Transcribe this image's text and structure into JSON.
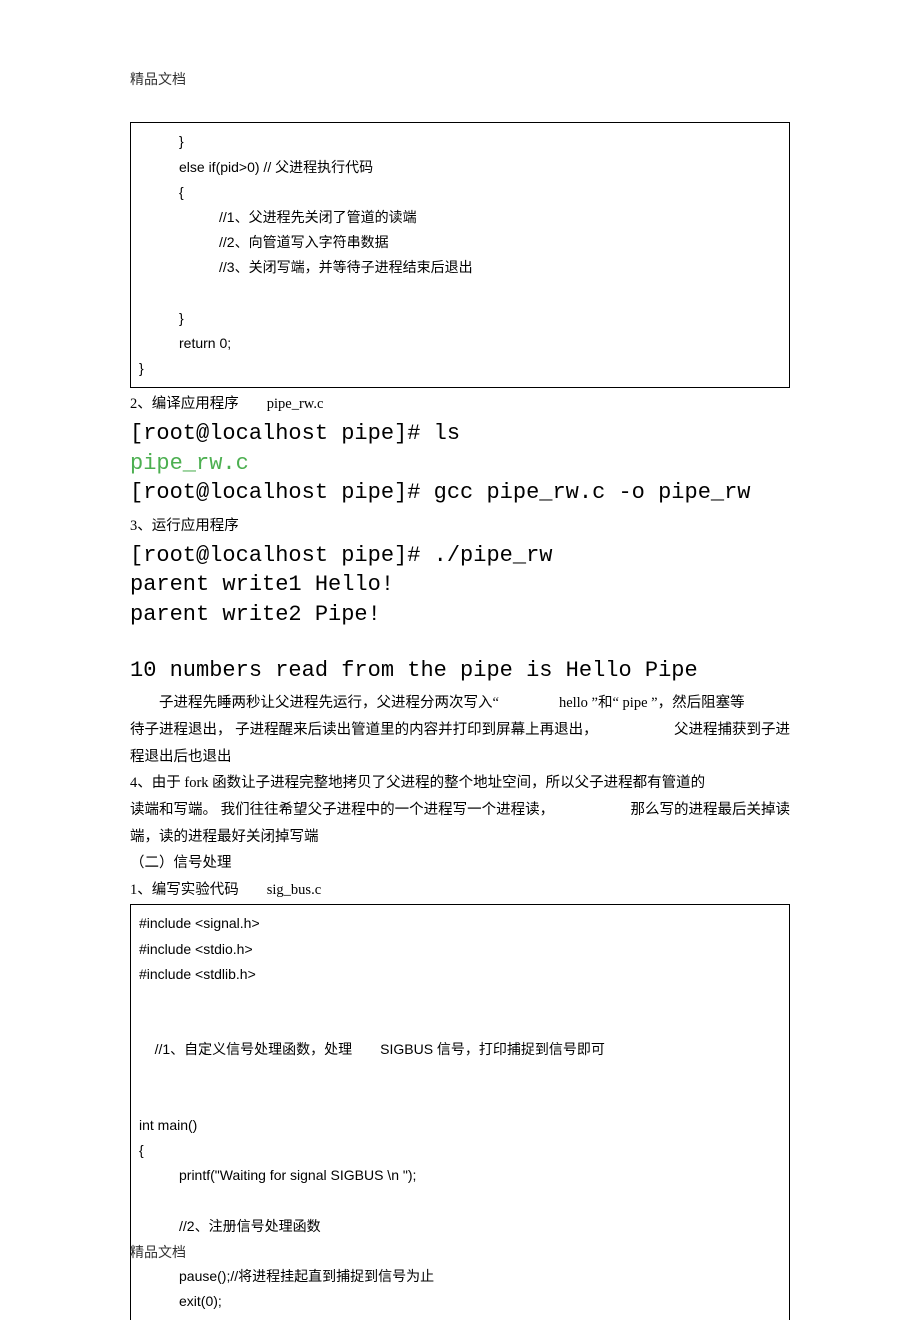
{
  "header": {
    "text": "精品文档"
  },
  "footer": {
    "text": "精品文档"
  },
  "code_block_1": {
    "l1": "}",
    "l2": "else if(pid>0) // 父进程执行代码",
    "l3": "{",
    "l4": "//1、父进程先关闭了管道的读端",
    "l5": "//2、向管道写入字符串数据",
    "l6": "//3、关闭写端，并等待子进程结束后退出",
    "l7": "}",
    "l8": "return 0;",
    "l9": "}"
  },
  "step2": {
    "label": "2、编译应用程序",
    "file": "pipe_rw.c"
  },
  "terminal1": {
    "l1": "[root@localhost pipe]# ls",
    "l2": "pipe_rw.c",
    "l3": "[root@localhost pipe]# gcc pipe_rw.c -o pipe_rw"
  },
  "step3": {
    "label": "3、运行应用程序"
  },
  "terminal2": {
    "l1": "[root@localhost pipe]# ./pipe_rw",
    "l2": "parent write1 Hello!",
    "l3": "parent write2 Pipe!",
    "l4": "10 numbers read from the pipe is Hello Pipe"
  },
  "paragraph1": {
    "part1": "子进程先睡两秒让父进程先运行，父进程分两次写入“",
    "part2": "hello ”和“ pipe ”，然后阻塞等",
    "line2a": "待子进程退出，  子进程醒来后读出管道里的内容并打印到屏幕上再退出，",
    "line2b": "父进程捕获到子进",
    "line3": "程退出后也退出"
  },
  "step4": {
    "line1": "4、由于 fork 函数让子进程完整地拷贝了父进程的整个地址空间，所以父子进程都有管道的",
    "line2a": "读端和写端。  我们往往希望父子进程中的一个进程写一个进程读，",
    "line2b": "那么写的进程最后关掉读",
    "line3": "端，读的进程最好关闭掉写端"
  },
  "section2": {
    "title": "（二）信号处理"
  },
  "step1b": {
    "label": "1、编写实验代码",
    "file": "sig_bus.c"
  },
  "code_block_2": {
    "l1": "#include <signal.h>",
    "l2": "#include <stdio.h>",
    "l3": "#include <stdlib.h>",
    "l4a": "//1、自定义信号处理函数，处理",
    "l4b": "SIGBUS 信号，打印捕捉到信号即可",
    "l5": "int main()",
    "l6": "{",
    "l7": "printf(\"Waiting for signal SIGBUS \\n \");",
    "l8": "//2、注册信号处理函数",
    "l9": "pause();//将进程挂起直到捕捉到信号为止",
    "l10": "exit(0);"
  }
}
